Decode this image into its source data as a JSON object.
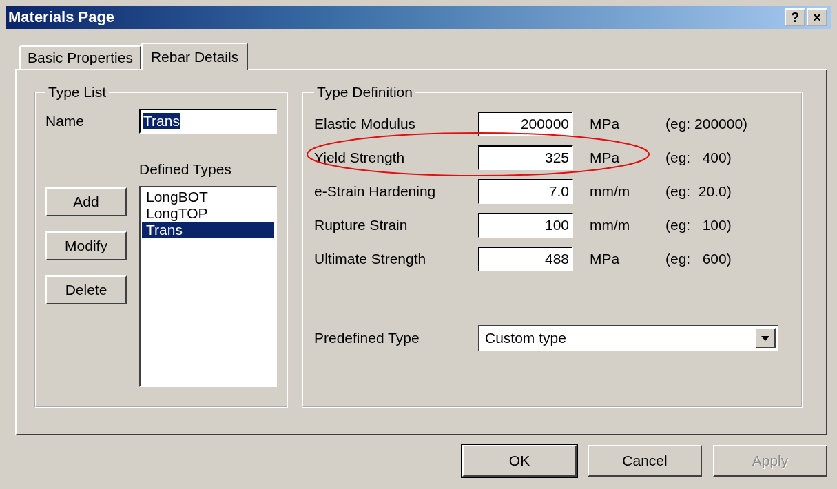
{
  "window": {
    "title": "Materials Page",
    "help_button": "?",
    "close_button": "×"
  },
  "tabs": [
    {
      "label": "Basic Properties",
      "selected": false
    },
    {
      "label": "Rebar Details",
      "selected": true
    }
  ],
  "type_list": {
    "title": "Type List",
    "name_label": "Name",
    "name_value": "Trans",
    "name_value_selected": true,
    "defined_types_label": "Defined Types",
    "buttons": [
      "Add",
      "Modify",
      "Delete"
    ],
    "items": [
      {
        "label": "LongBOT",
        "selected": false
      },
      {
        "label": "LongTOP",
        "selected": false
      },
      {
        "label": "Trans",
        "selected": true
      }
    ]
  },
  "type_definition": {
    "title": "Type Definition",
    "rows": [
      {
        "label": "Elastic Modulus",
        "value": "200000",
        "unit": "MPa",
        "example": "(eg: 200000)",
        "highlighted": false
      },
      {
        "label": "Yield Strength",
        "value": "325",
        "unit": "MPa",
        "example": "(eg:   400)",
        "highlighted": true
      },
      {
        "label": "e-Strain Hardening",
        "value": "7.0",
        "unit": "mm/m",
        "example": "(eg:  20.0)",
        "highlighted": false
      },
      {
        "label": "Rupture Strain",
        "value": "100",
        "unit": "mm/m",
        "example": "(eg:   100)",
        "highlighted": false
      },
      {
        "label": "Ultimate Strength",
        "value": "488",
        "unit": "MPa",
        "example": "(eg:   600)",
        "highlighted": false
      }
    ],
    "predefined_label": "Predefined Type",
    "predefined_value": "Custom type"
  },
  "footer_buttons": [
    {
      "label": "OK",
      "default": true,
      "disabled": false
    },
    {
      "label": "Cancel",
      "default": false,
      "disabled": false
    },
    {
      "label": "Apply",
      "default": false,
      "disabled": true
    }
  ]
}
